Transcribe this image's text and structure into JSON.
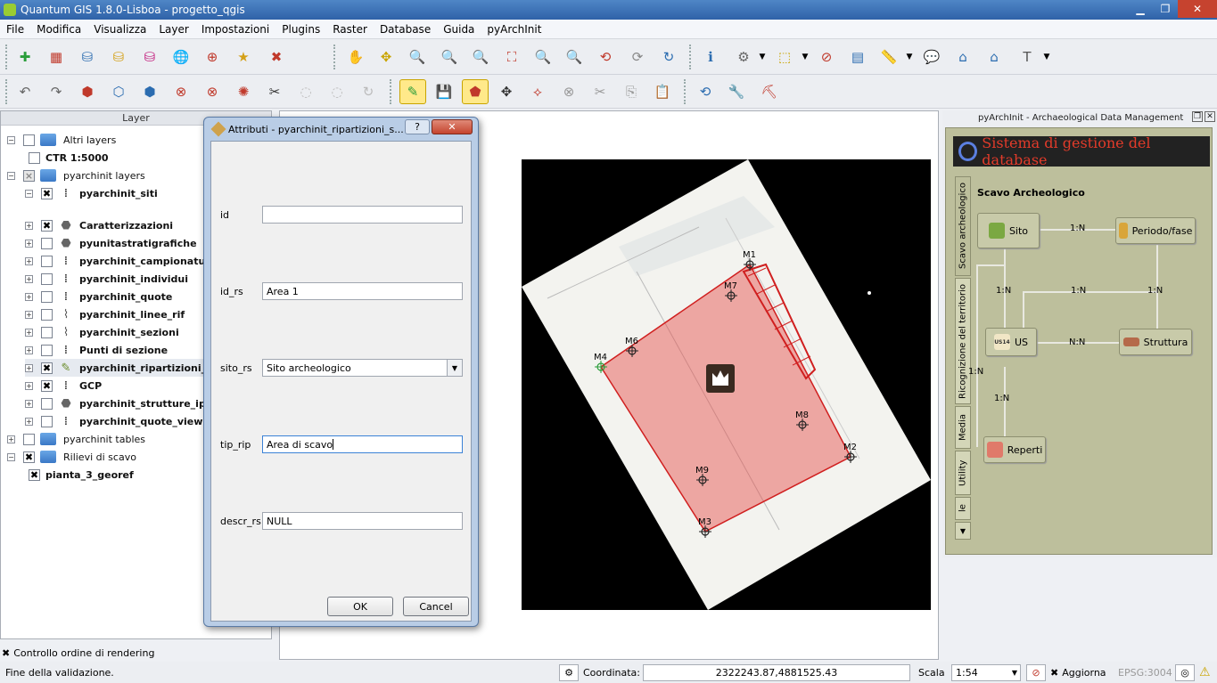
{
  "window": {
    "title": "Quantum GIS 1.8.0-Lisboa - progetto_qgis",
    "min_icon": "minimize-icon",
    "max_icon": "maximize-icon",
    "close_icon": "close-icon"
  },
  "menu": [
    "File",
    "Modifica",
    "Visualizza",
    "Layer",
    "Impostazioni",
    "Plugins",
    "Raster",
    "Database",
    "Guida",
    "pyArchInit"
  ],
  "layer_panel": {
    "title": "Layer",
    "items": [
      {
        "label": "Altri layers",
        "level": 0,
        "checkbox": "",
        "expanded": true,
        "icon": "folder-icon"
      },
      {
        "label": "CTR 1:5000",
        "level": 1,
        "checkbox": "",
        "expanded": null,
        "icon": ""
      },
      {
        "label": "pyarchinit layers",
        "level": 0,
        "checkbox": "×",
        "expanded": true,
        "icon": "folder-icon"
      },
      {
        "label": "pyarchinit_siti",
        "level": 1,
        "checkbox": "✖",
        "expanded": true,
        "icon": "points-icon"
      },
      {
        "label": "Caratterizzazioni",
        "level": 1,
        "checkbox": "✖",
        "expanded": false,
        "icon": "polygon-icon"
      },
      {
        "label": "pyunitastratigrafiche",
        "level": 1,
        "checkbox": "",
        "expanded": false,
        "icon": "polygon-icon"
      },
      {
        "label": "pyarchinit_campionature",
        "level": 1,
        "checkbox": "",
        "expanded": false,
        "icon": "points-icon"
      },
      {
        "label": "pyarchinit_individui",
        "level": 1,
        "checkbox": "",
        "expanded": false,
        "icon": "points-icon"
      },
      {
        "label": "pyarchinit_quote",
        "level": 1,
        "checkbox": "",
        "expanded": false,
        "icon": "points-icon"
      },
      {
        "label": "pyarchinit_linee_rif",
        "level": 1,
        "checkbox": "",
        "expanded": false,
        "icon": "line-icon"
      },
      {
        "label": "pyarchinit_sezioni",
        "level": 1,
        "checkbox": "",
        "expanded": false,
        "icon": "line-icon"
      },
      {
        "label": "Punti di sezione",
        "level": 1,
        "checkbox": "",
        "expanded": false,
        "icon": "points-icon"
      },
      {
        "label": "pyarchinit_ripartizioni_spaz",
        "level": 1,
        "checkbox": "✖",
        "expanded": false,
        "icon": "pencil-icon"
      },
      {
        "label": "GCP",
        "level": 1,
        "checkbox": "✖",
        "expanded": false,
        "icon": "points-icon"
      },
      {
        "label": "pyarchinit_strutture_ipotes",
        "level": 1,
        "checkbox": "",
        "expanded": false,
        "icon": "polygon-icon"
      },
      {
        "label": "pyarchinit_quote_view",
        "level": 1,
        "checkbox": "",
        "expanded": false,
        "icon": "points-icon"
      },
      {
        "label": "pyarchinit tables",
        "level": 0,
        "checkbox": "",
        "expanded": false,
        "icon": "folder-icon"
      },
      {
        "label": "Rilievi di scavo",
        "level": 0,
        "checkbox": "✖",
        "expanded": true,
        "icon": "folder-icon"
      },
      {
        "label": "pianta_3_georef",
        "level": 1,
        "checkbox": "✖",
        "expanded": null,
        "icon": ""
      }
    ],
    "render_order_label": "Controllo ordine di rendering",
    "render_order_checked": "✖"
  },
  "dialog": {
    "title": "Attributi - pyarchinit_ripartizioni_s...",
    "help": "?",
    "close": "✕",
    "fields": [
      {
        "label": "id",
        "value": "",
        "type": "text"
      },
      {
        "label": "id_rs",
        "value": "Area 1",
        "type": "text"
      },
      {
        "label": "sito_rs",
        "value": "Sito archeologico",
        "type": "select"
      },
      {
        "label": "tip_rip",
        "value": "Area di scavo",
        "type": "text"
      },
      {
        "label": "descr_rs",
        "value": "NULL",
        "type": "text"
      }
    ],
    "ok": "OK",
    "cancel": "Cancel"
  },
  "map": {
    "points": [
      {
        "label": "M1"
      },
      {
        "label": "M7"
      },
      {
        "label": "M6"
      },
      {
        "label": "M4"
      },
      {
        "label": "M8"
      },
      {
        "label": "M2"
      },
      {
        "label": "M9"
      },
      {
        "label": "M3"
      }
    ],
    "polygon_color": "#e64a45",
    "background": "#000000"
  },
  "pyarchinit": {
    "panel_title": "pyArchInit - Archaeological Data Management",
    "banner": "Sistema di gestione del database",
    "section_title": "Scavo Archeologico",
    "tabs": [
      "Scavo archeologico",
      "Ricognizione del territorio",
      "Media",
      "Utility",
      "le"
    ],
    "buttons": {
      "sito": "Sito",
      "periodo": "Periodo/fase",
      "us": "US",
      "struttura": "Struttura",
      "reperti": "Reperti"
    },
    "relations": {
      "sito_periodo": "1:N",
      "sito_us": "1:N",
      "us_mid": "1:N",
      "periodo_struttura": "1:N",
      "us_struttura": "N:N",
      "us_reperti_left": "1:N",
      "us_reperti": "1:N"
    },
    "us_badge": "US14"
  },
  "status": {
    "message": "Fine della validazione.",
    "coord_label": "Coordinata:",
    "coord_value": "2322243.87,4881525.43",
    "scale_label": "Scala",
    "scale_value": "1:54",
    "render_label": "Aggiorna",
    "render_checked": "✖",
    "epsg": "EPSG:3004"
  }
}
